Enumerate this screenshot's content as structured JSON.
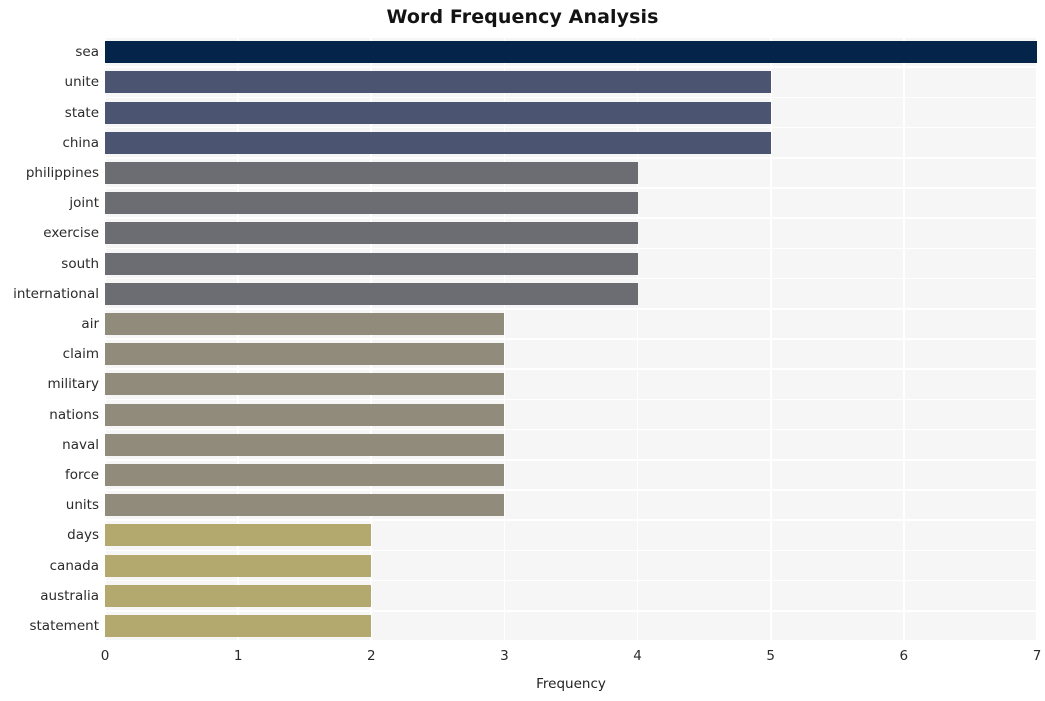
{
  "chart_data": {
    "type": "bar",
    "orientation": "horizontal",
    "title": "Word Frequency Analysis",
    "xlabel": "Frequency",
    "ylabel": "",
    "xlim": [
      0,
      7
    ],
    "ylim": [
      0,
      20
    ],
    "xticks": [
      0,
      1,
      2,
      3,
      4,
      5,
      6,
      7
    ],
    "xtick_labels": [
      "0",
      "1",
      "2",
      "3",
      "4",
      "5",
      "6",
      "7"
    ],
    "grid": true,
    "grid_color": "#ffffff",
    "plot_background": "#f6f6f7",
    "figure_background": "#ffffff",
    "legend": null,
    "categories": [
      "sea",
      "unite",
      "state",
      "china",
      "philippines",
      "joint",
      "exercise",
      "south",
      "international",
      "air",
      "claim",
      "military",
      "nations",
      "naval",
      "force",
      "units",
      "days",
      "canada",
      "australia",
      "statement"
    ],
    "values": [
      7,
      5,
      5,
      5,
      4,
      4,
      4,
      4,
      4,
      3,
      3,
      3,
      3,
      3,
      3,
      3,
      2,
      2,
      2,
      2
    ],
    "bar_colors": [
      "#052449",
      "#4b5470",
      "#4b5470",
      "#4b5470",
      "#6b6d72",
      "#6b6d72",
      "#6b6d72",
      "#6b6d72",
      "#6b6d72",
      "#918b7c",
      "#918b7c",
      "#918b7c",
      "#918b7c",
      "#918b7c",
      "#918b7c",
      "#918b7c",
      "#b3a86e",
      "#b3a86e",
      "#b3a86e",
      "#b3a86e"
    ],
    "bars": [
      {
        "label": "sea",
        "value": 7,
        "color": "#052449"
      },
      {
        "label": "unite",
        "value": 5,
        "color": "#4b5470"
      },
      {
        "label": "state",
        "value": 5,
        "color": "#4b5470"
      },
      {
        "label": "china",
        "value": 5,
        "color": "#4b5470"
      },
      {
        "label": "philippines",
        "value": 4,
        "color": "#6b6d72"
      },
      {
        "label": "joint",
        "value": 4,
        "color": "#6b6d72"
      },
      {
        "label": "exercise",
        "value": 4,
        "color": "#6b6d72"
      },
      {
        "label": "south",
        "value": 4,
        "color": "#6b6d72"
      },
      {
        "label": "international",
        "value": 4,
        "color": "#6b6d72"
      },
      {
        "label": "air",
        "value": 3,
        "color": "#918b7c"
      },
      {
        "label": "claim",
        "value": 3,
        "color": "#918b7c"
      },
      {
        "label": "military",
        "value": 3,
        "color": "#918b7c"
      },
      {
        "label": "nations",
        "value": 3,
        "color": "#918b7c"
      },
      {
        "label": "naval",
        "value": 3,
        "color": "#918b7c"
      },
      {
        "label": "force",
        "value": 3,
        "color": "#918b7c"
      },
      {
        "label": "units",
        "value": 3,
        "color": "#918b7c"
      },
      {
        "label": "days",
        "value": 2,
        "color": "#b3a86e"
      },
      {
        "label": "canada",
        "value": 2,
        "color": "#b3a86e"
      },
      {
        "label": "australia",
        "value": 2,
        "color": "#b3a86e"
      },
      {
        "label": "statement",
        "value": 2,
        "color": "#b3a86e"
      }
    ]
  }
}
